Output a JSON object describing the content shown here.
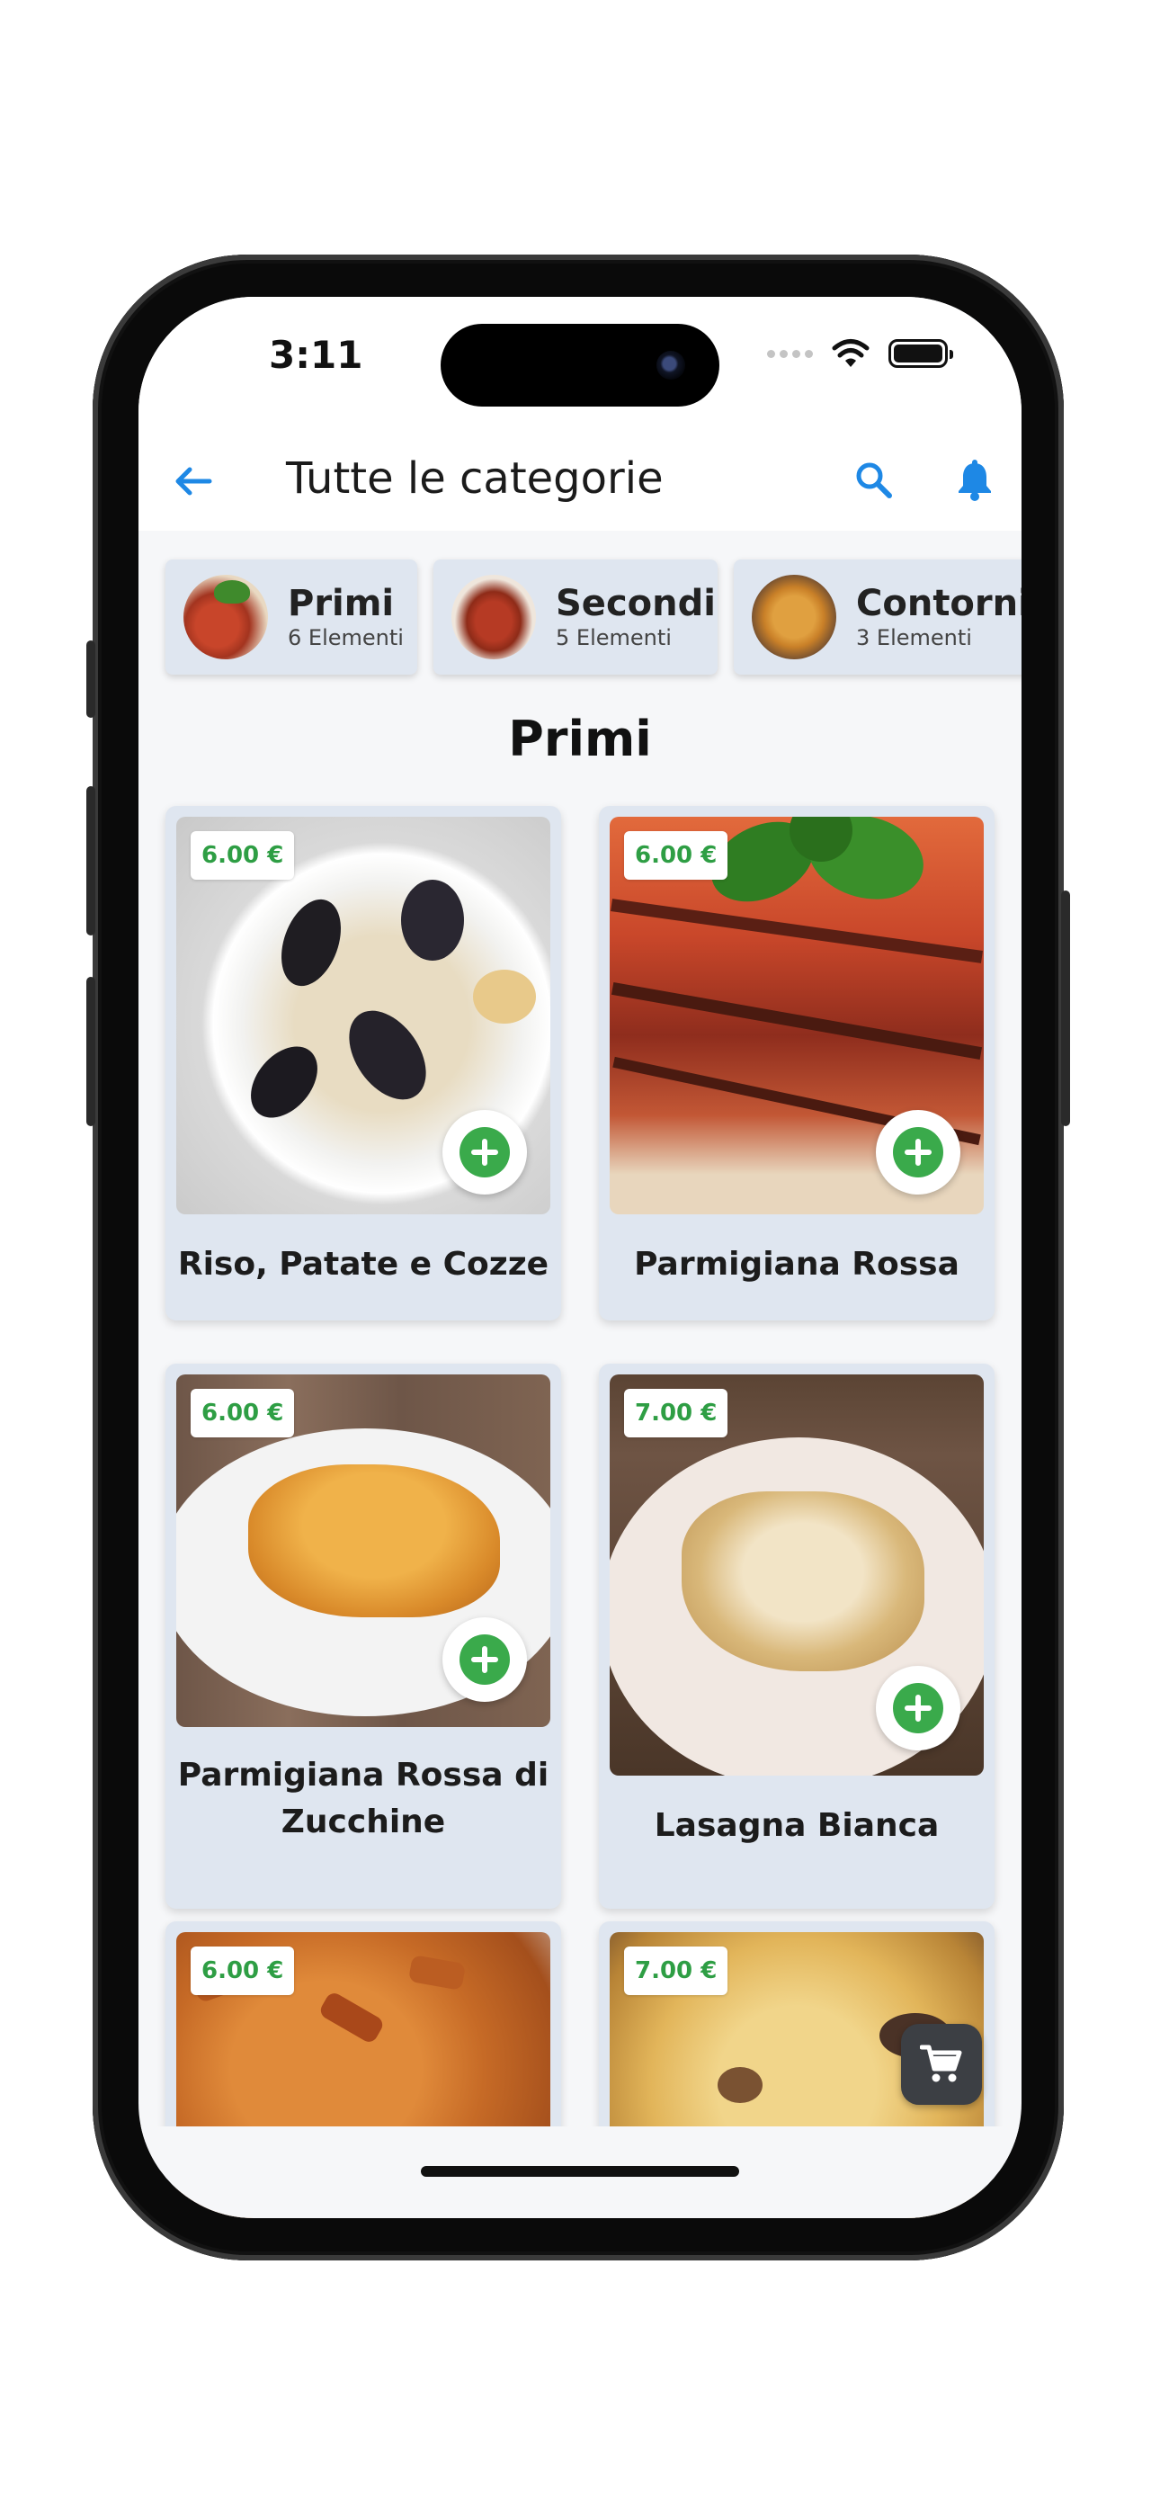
{
  "status_bar": {
    "time": "3:11"
  },
  "app_bar": {
    "title": "Tutte le categorie",
    "back_icon": "arrow-left-icon",
    "search_icon": "search-icon",
    "notification_icon": "bell-icon",
    "accent_color": "#1e88e5"
  },
  "categories": [
    {
      "name": "Primi",
      "count": "6 Elementi"
    },
    {
      "name": "Secondi",
      "count": "5 Elementi"
    },
    {
      "name": "Contorni",
      "count": "3 Elementi"
    }
  ],
  "section_title": "Primi",
  "products": [
    {
      "name": "Riso, Patate e Cozze",
      "price": "6.00 €"
    },
    {
      "name": "Parmigiana Rossa",
      "price": "6.00 €"
    },
    {
      "name": "Parmigiana Rossa di Zucchine",
      "price": "6.00 €"
    },
    {
      "name": "Lasagna Bianca",
      "price": "7.00 €"
    },
    {
      "name": "",
      "price": "6.00 €"
    },
    {
      "name": "",
      "price": "7.00 €"
    }
  ],
  "colors": {
    "price_green": "#2e9e44",
    "card_bg": "#dfe6f0",
    "add_green": "#3aaa4b"
  },
  "cart_icon": "cart-icon"
}
